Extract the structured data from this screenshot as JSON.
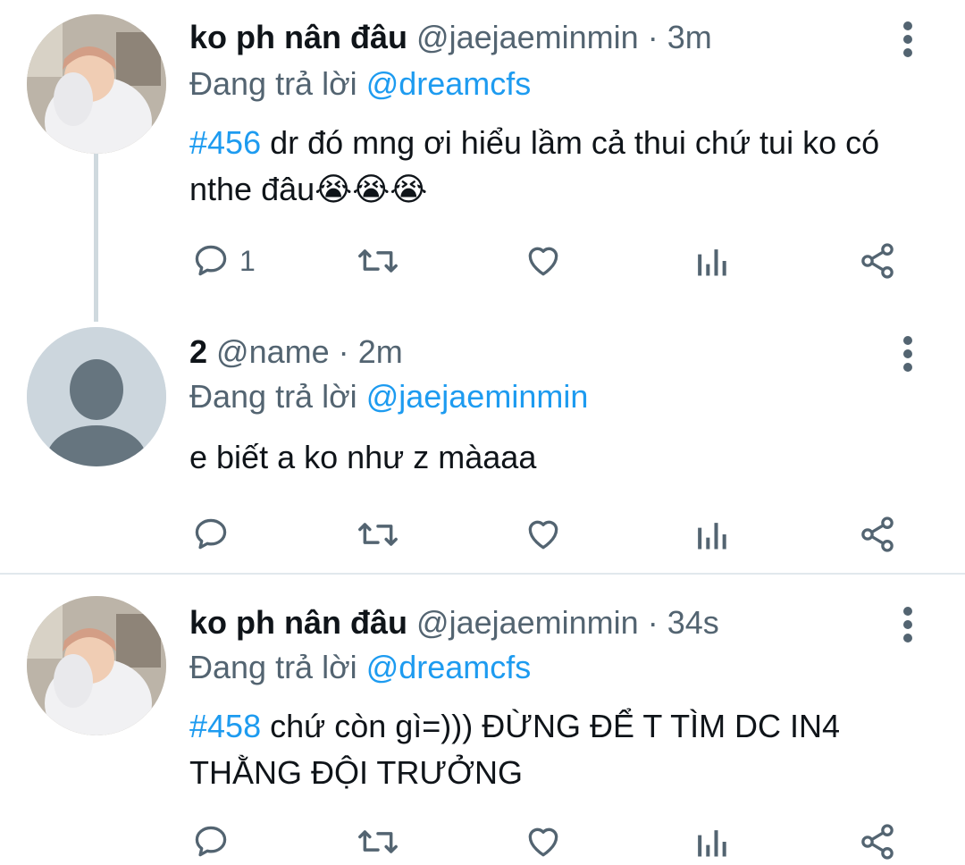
{
  "tweets": [
    {
      "name": "ko ph nân đâu",
      "handle": "@jaejaeminmin",
      "separator": "·",
      "time": "3m",
      "reply_prefix": "Đang trả lời",
      "reply_to": "@dreamcfs",
      "hashtag": "#456",
      "text": " dr đó mng ơi hiểu lầm cả thui chứ tui ko có nthe đâu😭😭😭",
      "reply_count": "1",
      "avatar": "user-photo"
    },
    {
      "name": "2",
      "handle": "@name",
      "separator": "·",
      "time": "2m",
      "reply_prefix": "Đang trả lời",
      "reply_to": "@jaejaeminmin",
      "hashtag": "",
      "text": "e biết a ko như z màaaa",
      "reply_count": "",
      "avatar": "default-profile"
    },
    {
      "name": "ko ph nân đâu",
      "handle": "@jaejaeminmin",
      "separator": "·",
      "time": "34s",
      "reply_prefix": "Đang trả lời",
      "reply_to": "@dreamcfs",
      "hashtag": "#458",
      "text": " chứ còn gì=))) ĐỪNG ĐỂ T TÌM DC IN4 THẰNG ĐỘI TRƯỞNG",
      "reply_count": "",
      "avatar": "user-photo"
    }
  ],
  "icons": {
    "reply": "reply-icon",
    "retweet": "retweet-icon",
    "like": "heart-icon",
    "analytics": "analytics-icon",
    "share": "share-icon",
    "more": "more-vertical-icon"
  },
  "colors": {
    "link": "#1d9bf0",
    "secondary_text": "#536471",
    "primary_text": "#0f1419",
    "thread_line": "#cfd9de"
  }
}
